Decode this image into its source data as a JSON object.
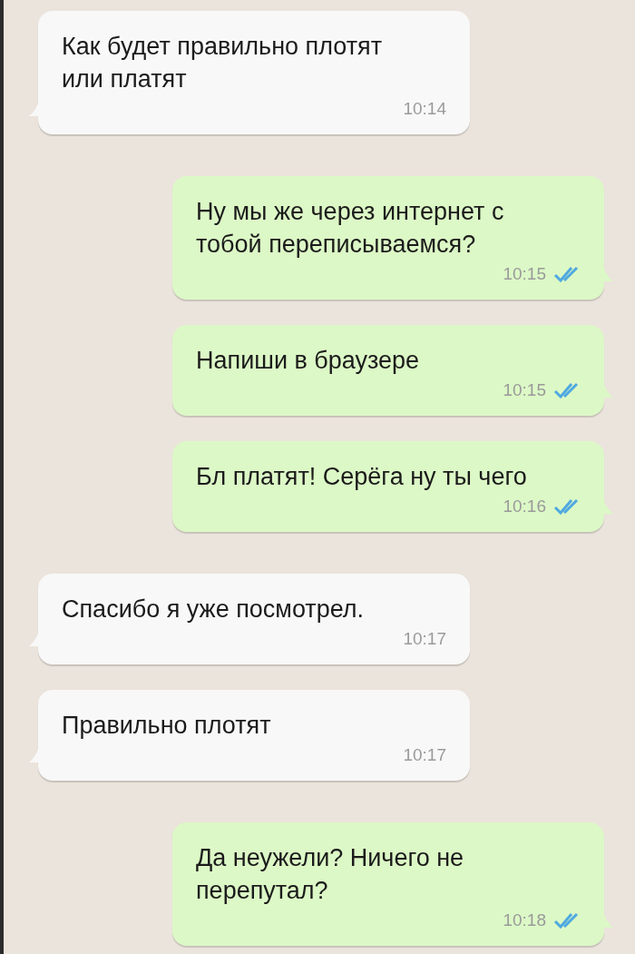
{
  "messages": [
    {
      "kind": "in",
      "text": "Как будет правильно плотят или платят",
      "time": "10:14"
    },
    {
      "kind": "out",
      "text": "Ну мы же через интернет с тобой переписываемся?",
      "time": "10:15",
      "read": true
    },
    {
      "kind": "out",
      "text": "Напиши в браузере",
      "time": "10:15",
      "read": true
    },
    {
      "kind": "out",
      "text": "Бл платят! Серёга ну ты чего",
      "time": "10:16",
      "read": true
    },
    {
      "kind": "in",
      "text": "Спасибо я уже посмотрел.",
      "time": "10:17"
    },
    {
      "kind": "in",
      "text": "Правильно плотят",
      "time": "10:17"
    },
    {
      "kind": "out",
      "text": "Да неужели? Ничего не перепутал?",
      "time": "10:18",
      "read": true
    }
  ]
}
